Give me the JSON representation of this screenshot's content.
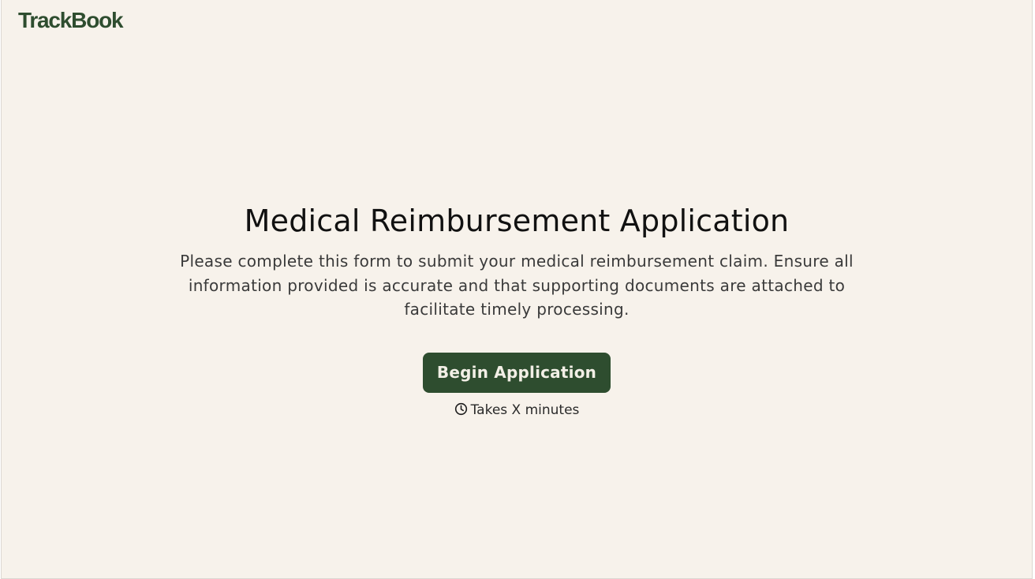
{
  "header": {
    "logo_text": "TrackBook"
  },
  "main": {
    "title": "Medical Reimbursement Application",
    "description": "Please complete this form to submit your medical reimbursement claim. Ensure all information provided is accurate and that supporting documents are attached to facilitate timely processing.",
    "begin_button_label": "Begin Application",
    "duration_text": "Takes X minutes",
    "duration_icon": "clock-icon"
  },
  "colors": {
    "background": "#f7f2eb",
    "brand_green": "#2e4d2f",
    "button_text": "#f2efe6",
    "title_text": "#111111",
    "body_text": "#3a3a3a"
  }
}
